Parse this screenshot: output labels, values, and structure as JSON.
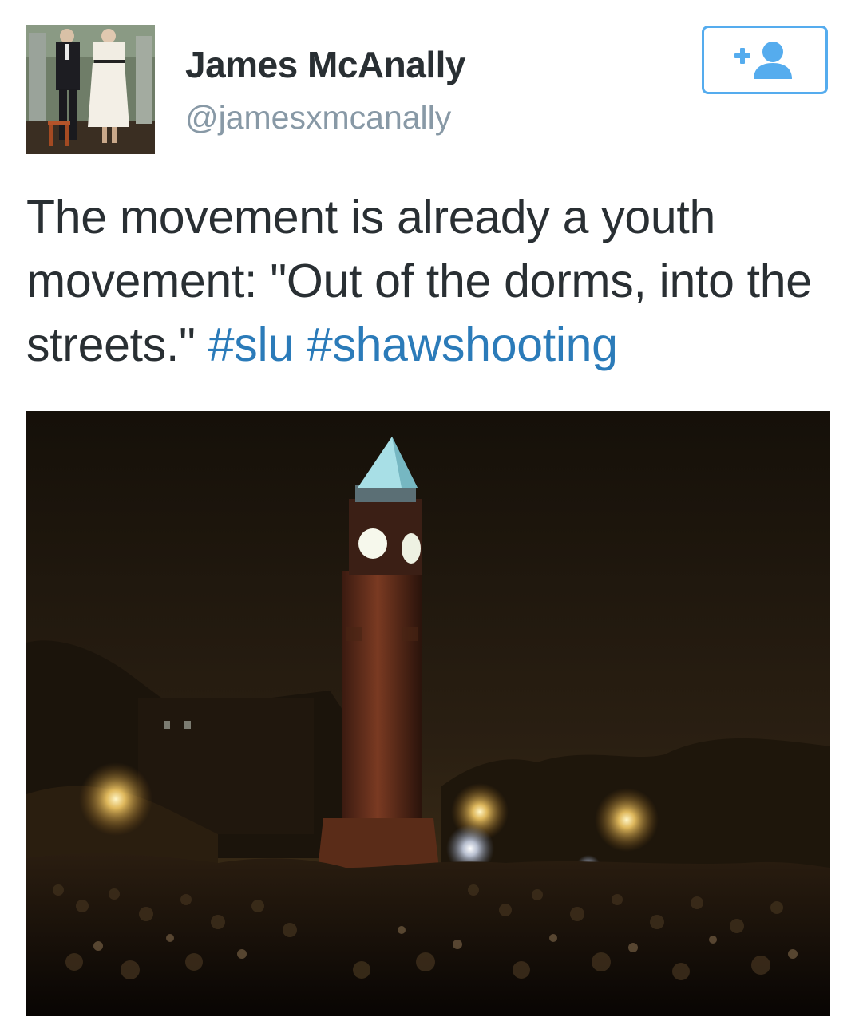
{
  "user": {
    "display_name": "James McAnally",
    "handle": "@jamesxmcanally"
  },
  "follow_button": {
    "icon": "add-person-icon",
    "color": "#55acee"
  },
  "tweet": {
    "text_part1": "The movement is already a youth movement: \"Out of the dorms, into the streets.\"",
    "hashtags": [
      "#slu",
      "#shawshooting"
    ]
  },
  "colors": {
    "text": "#292f33",
    "handle": "#8899a6",
    "hashtag": "#2b7bb9",
    "accent": "#55acee"
  }
}
